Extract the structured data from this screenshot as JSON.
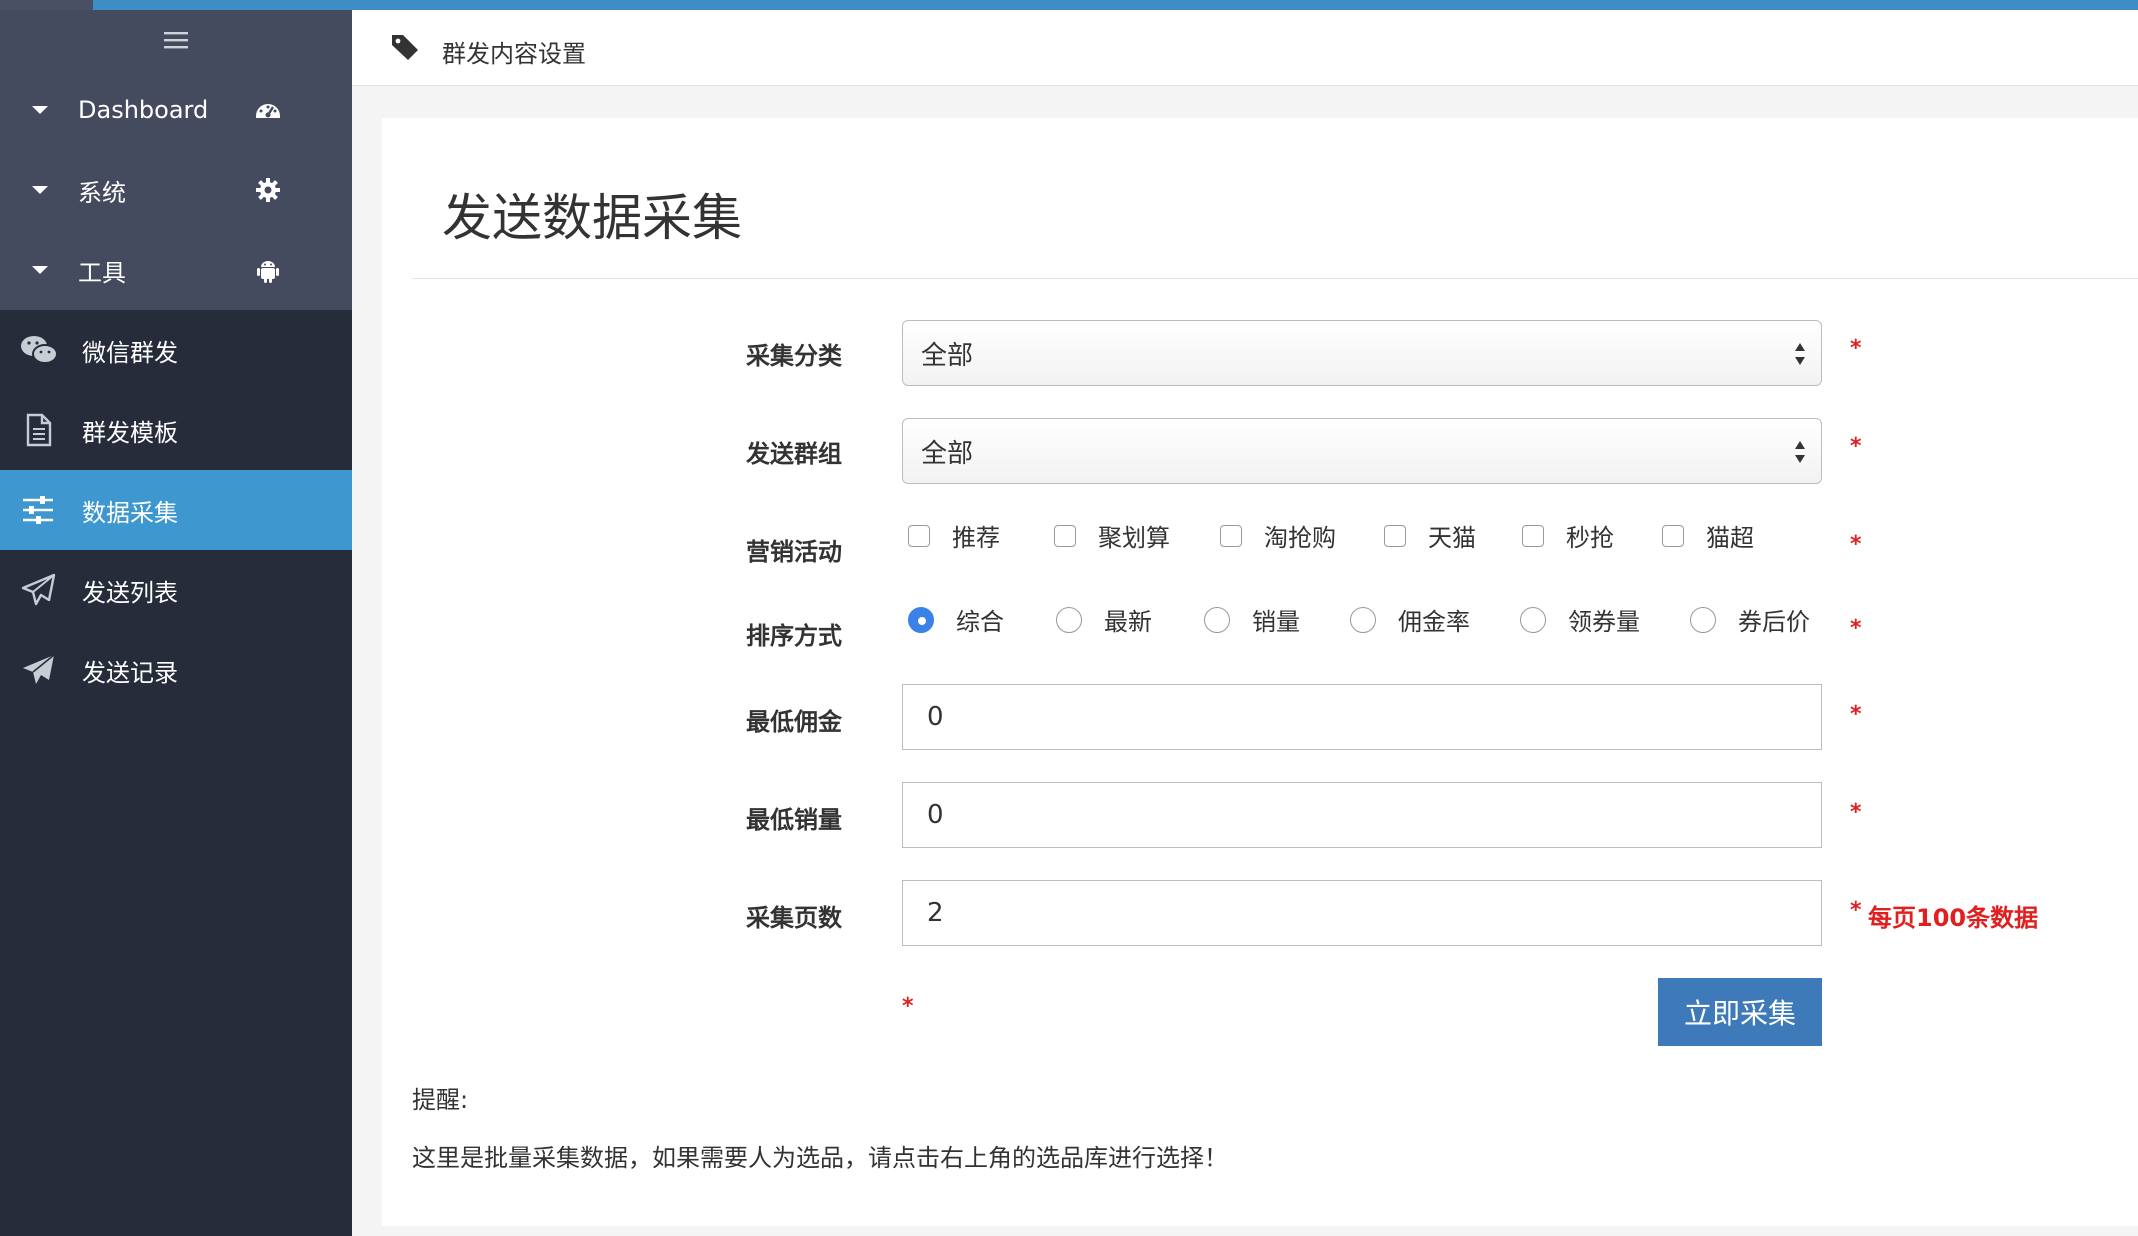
{
  "sidebar": {
    "menu_toggle": "≡",
    "groups": [
      {
        "label": "Dashboard",
        "icon": "dashboard-icon"
      },
      {
        "label": "系统",
        "icon": "gear-icon"
      },
      {
        "label": "工具",
        "icon": "android-icon"
      }
    ],
    "items": [
      {
        "label": "微信群发",
        "icon": "wechat-icon"
      },
      {
        "label": "群发模板",
        "icon": "file-icon"
      },
      {
        "label": "数据采集",
        "icon": "sliders-icon",
        "active": true
      },
      {
        "label": "发送列表",
        "icon": "paper-plane-outline-icon"
      },
      {
        "label": "发送记录",
        "icon": "paper-plane-icon"
      }
    ]
  },
  "breadcrumb": {
    "icon": "tag-icon",
    "text": "群发内容设置"
  },
  "page": {
    "title": "发送数据采集",
    "required_mark": "*",
    "fields": {
      "category": {
        "label": "采集分类",
        "value": "全部"
      },
      "group": {
        "label": "发送群组",
        "value": "全部"
      },
      "activity": {
        "label": "营销活动",
        "options": [
          "推荐",
          "聚划算",
          "淘抢购",
          "天猫",
          "秒抢",
          "猫超"
        ]
      },
      "sort": {
        "label": "排序方式",
        "options": [
          "综合",
          "最新",
          "销量",
          "佣金率",
          "领券量",
          "券后价"
        ],
        "selected": "综合"
      },
      "min_commission": {
        "label": "最低佣金",
        "value": "0"
      },
      "min_sales": {
        "label": "最低销量",
        "value": "0"
      },
      "pages": {
        "label": "采集页数",
        "value": "2",
        "hint": "每页100条数据"
      }
    },
    "submit_label": "立即采集",
    "notes": {
      "title": "提醒:",
      "text": "这里是批量采集数据，如果需要人为选品，请点击右上角的选品库进行选择！"
    }
  },
  "colors": {
    "accent": "#3e98cf",
    "button": "#3e7ab9",
    "required": "#e02020",
    "sidebar": "#262c39"
  }
}
